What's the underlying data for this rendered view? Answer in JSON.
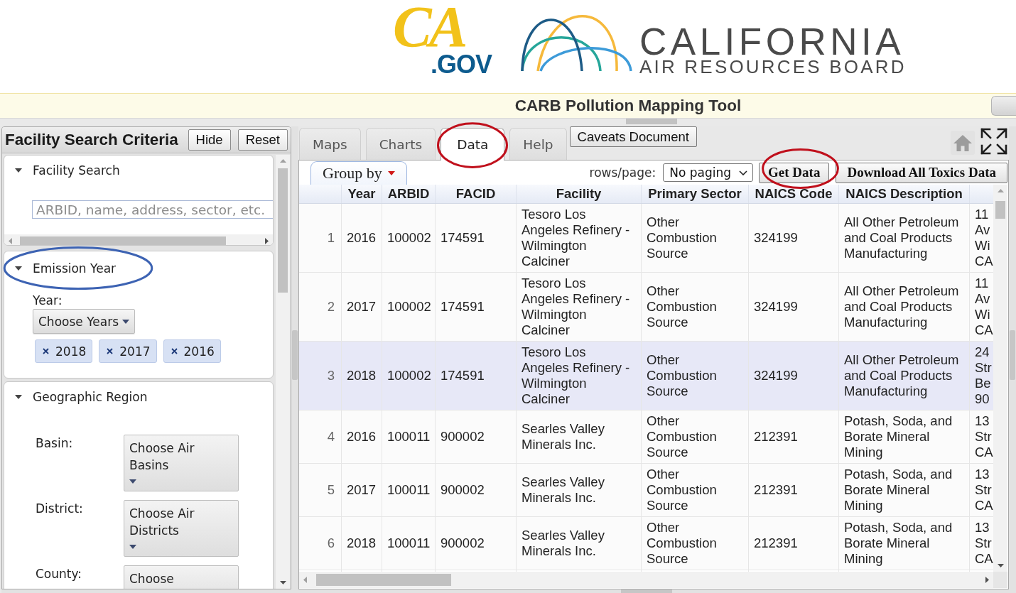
{
  "header": {
    "logo": {
      "mark": "CA",
      "suffix": ".GOV"
    },
    "agency": {
      "name": "CALIFORNIA",
      "subtitle": "AIR RESOURCES BOARD"
    }
  },
  "title_bar": {
    "title": "CARB Pollution Mapping Tool"
  },
  "search_panel": {
    "title": "Facility Search Criteria",
    "buttons": [
      "Hide",
      "Reset"
    ],
    "sections": [
      {
        "kind": "search",
        "title": "Facility Search",
        "expanded": true,
        "circled": false,
        "placeholder": "ARBID, name, address, sector, etc."
      },
      {
        "kind": "years",
        "title": "Emission Year",
        "expanded": true,
        "circled": true,
        "color": "#3d63b3",
        "label": "Year:",
        "dropdown": "Choose Years",
        "chips": [
          "2018",
          "2017",
          "2016"
        ]
      },
      {
        "kind": "region",
        "title": "Geographic Region",
        "expanded": true,
        "circled": false,
        "fields": [
          {
            "label": "Basin:",
            "dropdown": "Choose Air Basins"
          },
          {
            "label": "District:",
            "dropdown": "Choose Air Districts"
          },
          {
            "label": "County:",
            "dropdown": "Choose"
          }
        ]
      }
    ]
  },
  "data_panel": {
    "tabs": [
      {
        "label": "Maps",
        "selected": false,
        "circled": false
      },
      {
        "label": "Charts",
        "selected": false,
        "circled": false
      },
      {
        "label": "Data",
        "selected": true,
        "circled": true,
        "color": "#c0101c"
      },
      {
        "label": "Help",
        "selected": false,
        "circled": false
      }
    ],
    "caveats_button": "Caveats Document",
    "group_by": "Group by",
    "rows_per_page": {
      "label": "rows/page:",
      "value": "No paging"
    },
    "buttons": [
      {
        "label": "Get Data",
        "circled": true,
        "color": "#c0101c"
      },
      {
        "label": "Download All Toxics Data",
        "circled": false
      }
    ],
    "table": {
      "columns": [
        "Year",
        "ARBID",
        "FACID",
        "Facility",
        "Primary Sector",
        "NAICS Code",
        "NAICS Description"
      ],
      "rows": [
        {
          "number": "1",
          "selected": false,
          "cells": [
            "2016",
            "100002",
            "174591",
            "Tesoro Los Angeles Refinery - Wilmington Calciner",
            "Other Combustion Source",
            "324199",
            "All Other Petroleum and Coal Products Manufacturing"
          ],
          "column_9": "11 Av Wi CA"
        },
        {
          "number": "2",
          "selected": false,
          "cells": [
            "2017",
            "100002",
            "174591",
            "Tesoro Los Angeles Refinery - Wilmington Calciner",
            "Other Combustion Source",
            "324199",
            "All Other Petroleum and Coal Products Manufacturing"
          ],
          "column_9": "11 Av Wi CA"
        },
        {
          "number": "3",
          "selected": true,
          "cells": [
            "2018",
            "100002",
            "174591",
            "Tesoro Los Angeles Refinery - Wilmington Calciner",
            "Other Combustion Source",
            "324199",
            "All Other Petroleum and Coal Products Manufacturing"
          ],
          "column_9": "24 Str Be 90"
        },
        {
          "number": "4",
          "selected": false,
          "cells": [
            "2016",
            "100011",
            "900002",
            "Searles Valley Minerals Inc.",
            "Other Combustion Source",
            "212391",
            "Potash, Soda, and Borate Mineral Mining"
          ],
          "column_9": "13 Str CA"
        },
        {
          "number": "5",
          "selected": false,
          "cells": [
            "2017",
            "100011",
            "900002",
            "Searles Valley Minerals Inc.",
            "Other Combustion Source",
            "212391",
            "Potash, Soda, and Borate Mineral Mining"
          ],
          "column_9": "13 Str CA"
        },
        {
          "number": "6",
          "selected": false,
          "cells": [
            "2018",
            "100011",
            "900002",
            "Searles Valley Minerals Inc.",
            "Other Combustion Source",
            "212391",
            "Potash, Soda, and Borate Mineral Mining"
          ],
          "column_9": "13 Str CA"
        }
      ]
    }
  }
}
